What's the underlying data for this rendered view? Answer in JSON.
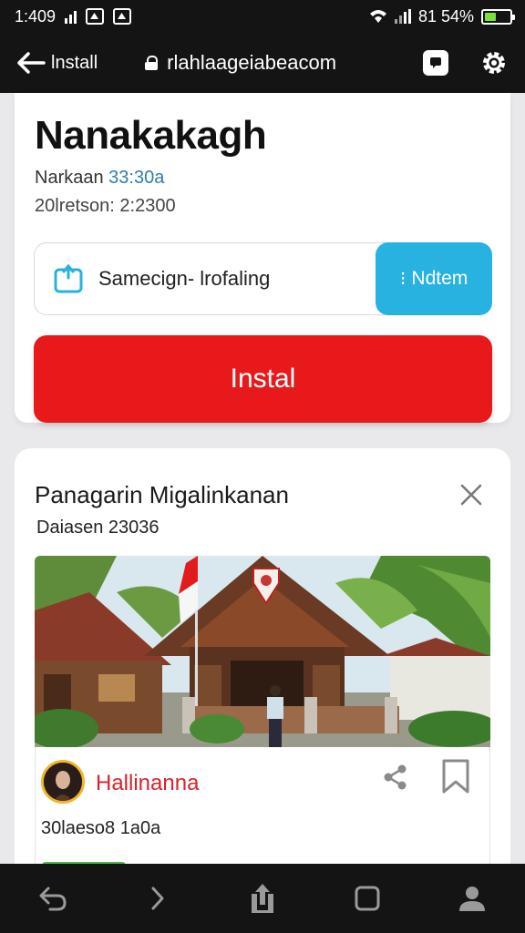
{
  "status_bar": {
    "time": "1:409",
    "battery_text": "81 54%"
  },
  "browser": {
    "back_label": "lnstall",
    "url": "rlahlaageiabeacom"
  },
  "app": {
    "title": "Nanakakagh",
    "version_label": "Narkaan",
    "version_value": "33:30a",
    "size_line": "20lretson: 2:2300",
    "info_text": "Samecign- lrofaling",
    "details_label": "Ndtem",
    "install_label": "Instal",
    "accent_blue": "#27b2e0",
    "install_red": "#e7191a"
  },
  "card": {
    "title": "Panagarin Migalinkanan",
    "date": "Daiasen 23036",
    "username": "Hallinanna",
    "caption": "30laeso8 1a0a"
  },
  "icons": [
    "back-arrow-icon",
    "lock-icon",
    "tabs-icon",
    "settings-icon",
    "info-box-icon",
    "close-icon",
    "share-icon",
    "bookmark-icon",
    "nav-back-icon",
    "nav-forward-icon",
    "nav-share-icon",
    "nav-tabs-icon",
    "nav-profile-icon"
  ]
}
